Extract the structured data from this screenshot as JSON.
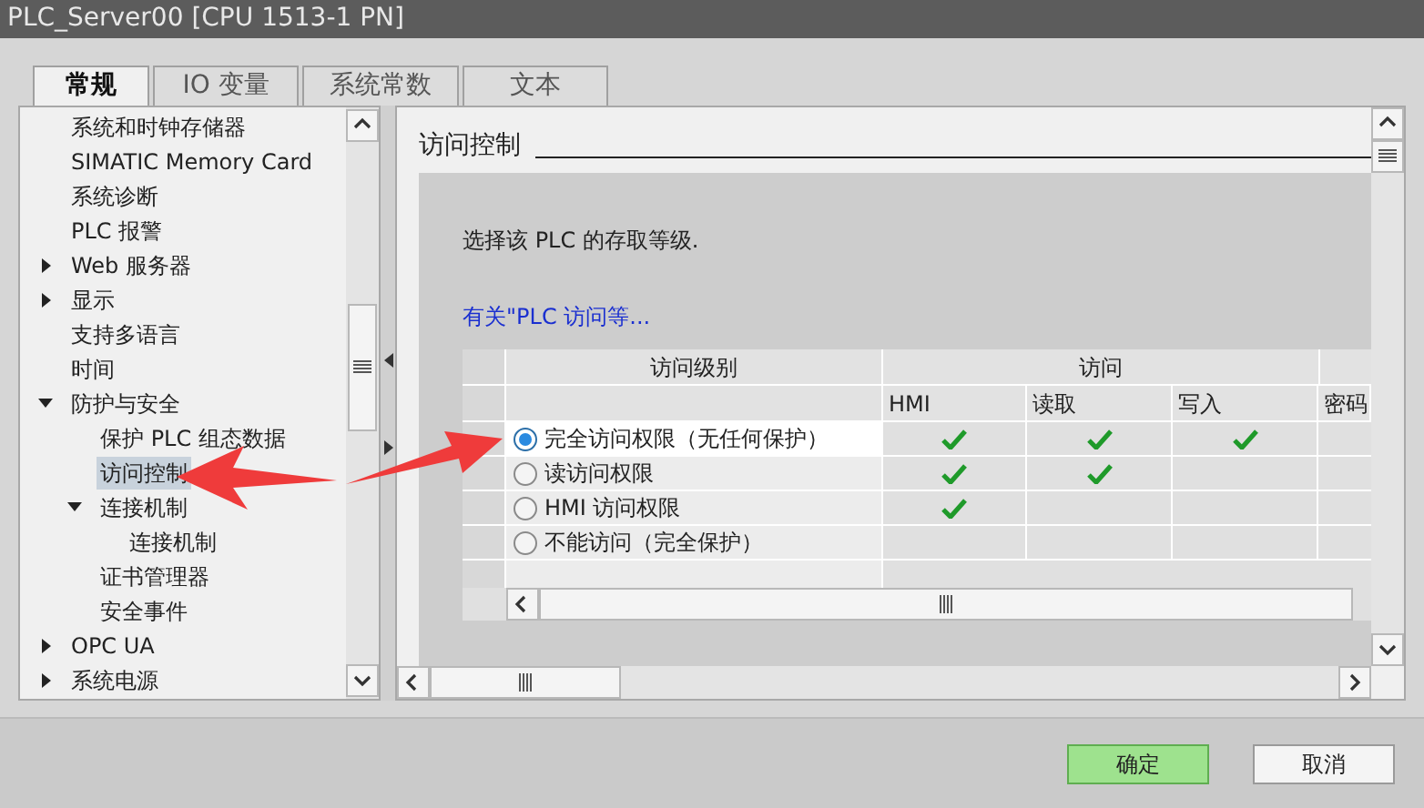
{
  "window": {
    "title": "PLC_Server00 [CPU 1513-1 PN]"
  },
  "tabs": [
    {
      "label": "常规",
      "selected": true
    },
    {
      "label": "IO 变量",
      "selected": false
    },
    {
      "label": "系统常数",
      "selected": false
    },
    {
      "label": "文本",
      "selected": false
    }
  ],
  "sidebar": {
    "items": [
      {
        "label": "系统和时钟存储器",
        "selected": false
      },
      {
        "label": "SIMATIC Memory Card",
        "selected": false
      },
      {
        "label": "系统诊断",
        "selected": false
      },
      {
        "label": "PLC 报警",
        "selected": false
      },
      {
        "label": "Web 服务器",
        "selected": false,
        "expanded": false
      },
      {
        "label": "显示",
        "selected": false,
        "expanded": false
      },
      {
        "label": "支持多语言",
        "selected": false
      },
      {
        "label": "时间",
        "selected": false
      },
      {
        "label": "防护与安全",
        "selected": false,
        "expanded": true,
        "children": [
          {
            "label": "保护 PLC 组态数据",
            "selected": false
          },
          {
            "label": "访问控制",
            "selected": true
          },
          {
            "label": "连接机制",
            "selected": false,
            "expanded": true,
            "children": [
              {
                "label": "连接机制",
                "selected": false
              }
            ]
          },
          {
            "label": "证书管理器",
            "selected": false
          },
          {
            "label": "安全事件",
            "selected": false
          }
        ]
      },
      {
        "label": "OPC UA",
        "selected": false,
        "expanded": false
      },
      {
        "label": "系统电源",
        "selected": false,
        "expanded": false
      }
    ]
  },
  "section": {
    "title": "访问控制",
    "description": "选择该 PLC 的存取等级.",
    "link": "有关\"PLC 访问等..."
  },
  "table": {
    "header": [
      "访问级别",
      "访问"
    ],
    "columns": [
      "HMI",
      "读取",
      "写入",
      "密码"
    ],
    "rows": [
      {
        "label": "完全访问权限（无任何保护）",
        "selected": true,
        "access": [
          true,
          true,
          true
        ]
      },
      {
        "label": "读访问权限",
        "selected": false,
        "access": [
          true,
          true,
          false
        ]
      },
      {
        "label": "HMI 访问权限",
        "selected": false,
        "access": [
          true,
          false,
          false
        ]
      },
      {
        "label": "不能访问（完全保护）",
        "selected": false,
        "access": [
          false,
          false,
          false
        ]
      }
    ]
  },
  "buttons": [
    {
      "label": "确定",
      "kind": "primary"
    },
    {
      "label": "取消",
      "kind": "secondary"
    }
  ]
}
